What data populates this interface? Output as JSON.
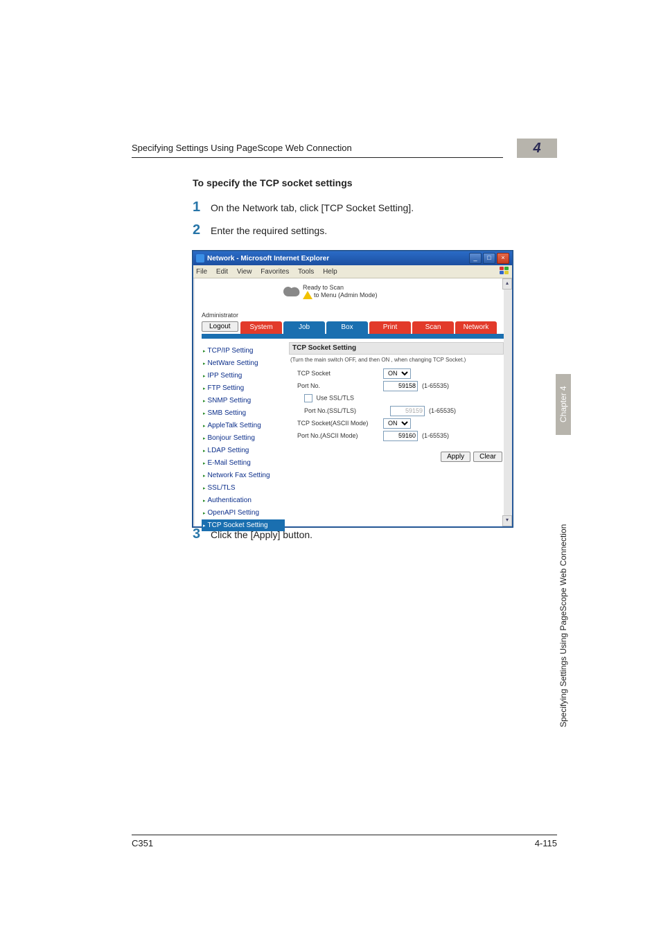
{
  "header": {
    "text": "Specifying Settings Using PageScope Web Connection",
    "chapter_number": "4"
  },
  "section": {
    "title": "To specify the TCP socket settings"
  },
  "steps": {
    "s1": {
      "num": "1",
      "text": "On the Network tab, click [TCP Socket Setting]."
    },
    "s2": {
      "num": "2",
      "text": "Enter the required settings."
    },
    "s3": {
      "num": "3",
      "text": "Click the [Apply] button."
    }
  },
  "screenshot": {
    "title": "Network - Microsoft Internet Explorer",
    "menus": {
      "file": "File",
      "edit": "Edit",
      "view": "View",
      "favorites": "Favorites",
      "tools": "Tools",
      "help": "Help"
    },
    "logo": {
      "line1": "Ready to Scan",
      "line2": "to Menu (Admin Mode)"
    },
    "admin_label": "Administrator",
    "logout": "Logout",
    "tabs": {
      "system": "System",
      "job": "Job",
      "box": "Box",
      "print": "Print",
      "scan": "Scan",
      "network": "Network"
    },
    "sidebar": [
      "TCP/IP Setting",
      "NetWare Setting",
      "IPP Setting",
      "FTP Setting",
      "SNMP Setting",
      "SMB Setting",
      "AppleTalk Setting",
      "Bonjour Setting",
      "LDAP Setting",
      "E-Mail Setting",
      "Network Fax Setting",
      "SSL/TLS",
      "Authentication",
      "OpenAPI Setting",
      "TCP Socket Setting"
    ],
    "panel": {
      "title": "TCP Socket Setting",
      "hint": "(Turn the main switch OFF, and then ON , when changing TCP Socket.)",
      "tcp_socket_label": "TCP Socket",
      "tcp_socket_value": "ON",
      "port_no_label": "Port No.",
      "port_no_value": "59158",
      "port_no_range": "(1-65535)",
      "use_ssl_label": "Use SSL/TLS",
      "use_ssl_checked": false,
      "port_no_ssl_label": "Port No.(SSL/TLS)",
      "port_no_ssl_value": "59159",
      "port_no_ssl_range": "(1-65535)",
      "ascii_mode_label": "TCP Socket(ASCII Mode)",
      "ascii_mode_value": "ON",
      "port_no_ascii_label": "Port No.(ASCII Mode)",
      "port_no_ascii_value": "59160",
      "port_no_ascii_range": "(1-65535)",
      "apply": "Apply",
      "clear": "Clear"
    }
  },
  "side_text": {
    "chapter": "Chapter 4",
    "section": "Specifying Settings Using PageScope Web Connection"
  },
  "footer": {
    "left": "C351",
    "right": "4-115"
  }
}
